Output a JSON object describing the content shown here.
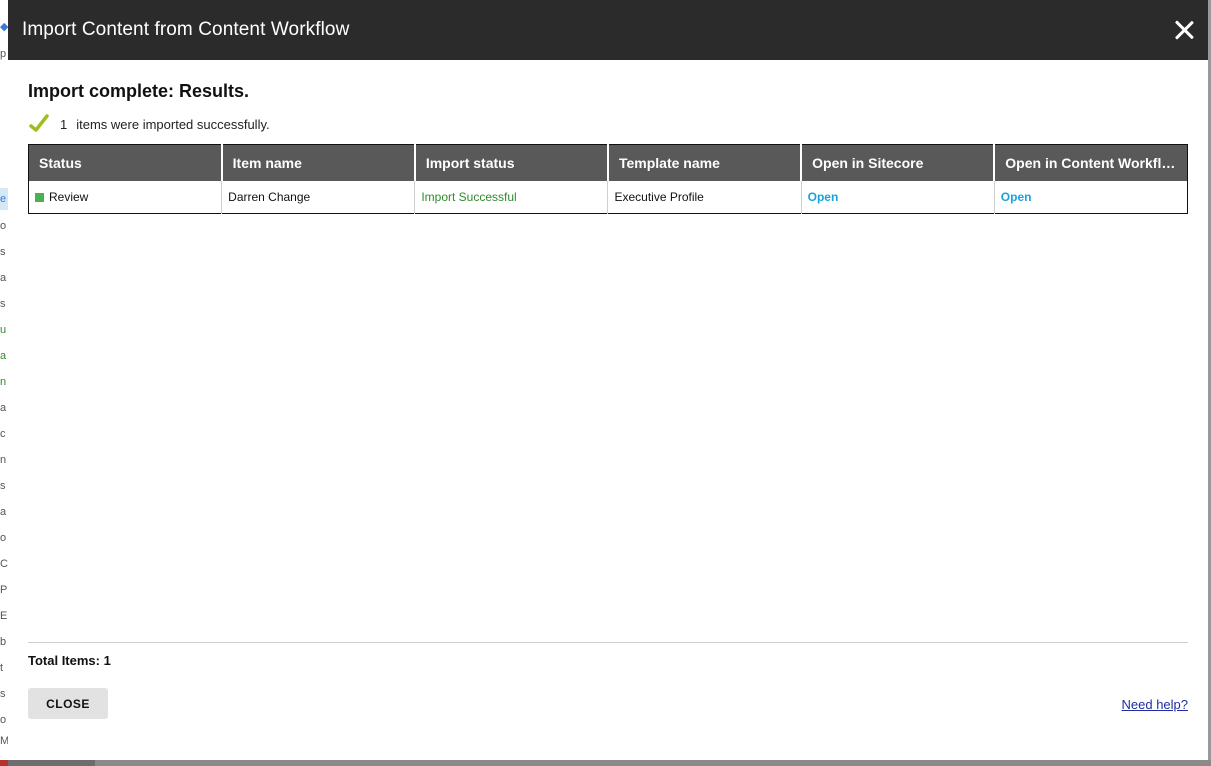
{
  "dialog": {
    "title": "Import Content from Content Workflow",
    "close_icon": "close-icon"
  },
  "results": {
    "heading": "Import complete: Results.",
    "success_count": "1",
    "success_text": "items were imported successfully.",
    "success_icon": "checkmark-icon"
  },
  "table": {
    "columns": [
      "Status",
      "Item name",
      "Import status",
      "Template name",
      "Open in Sitecore",
      "Open in Content Workfl…"
    ],
    "rows": [
      {
        "status": "Review",
        "status_color": "#4caf50",
        "item_name": "Darren Change",
        "import_status": "Import Successful",
        "template_name": "Executive Profile",
        "open_sitecore": "Open",
        "open_content_workflow": "Open"
      }
    ]
  },
  "footer": {
    "total_items": "Total Items: 1",
    "close_label": "CLOSE",
    "help_label": "Need help?"
  },
  "colors": {
    "titlebar": "#2b2b2b",
    "header": "#595959",
    "success_green": "#2e8b2e",
    "link_blue": "#1aa3d9",
    "check_green": "#9cbf1f"
  }
}
